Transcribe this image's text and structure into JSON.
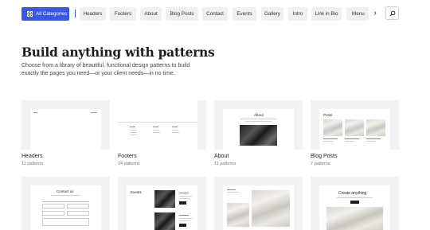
{
  "categories": {
    "active": "All Categories",
    "items": [
      "Headers",
      "Footers",
      "About",
      "Blog Posts",
      "Contact",
      "Events",
      "Gallery",
      "Intro",
      "Link in Bio",
      "Menu"
    ]
  },
  "heading": {
    "title": "Build anything with patterns",
    "subtitle": "Choose from a library of beautiful, functional design patterns to build exactly the pages you need—or your client needs—in no time."
  },
  "cards": [
    {
      "name": "Headers",
      "count": "11 patterns"
    },
    {
      "name": "Footers",
      "count": "14 patterns"
    },
    {
      "name": "About",
      "count": "11 patterns"
    },
    {
      "name": "Blog Posts",
      "count": "7 patterns"
    }
  ],
  "previews": {
    "about_heading": "About",
    "posts_heading": "Posts",
    "contact_heading": "Contact us",
    "events_heading": "Events",
    "create_heading": "Create anything"
  },
  "colors": {
    "accent": "#3858e9",
    "chip": "#f0f0f0",
    "card_bg": "#f2f2f2"
  },
  "icons": {
    "categories": "grid-icon",
    "scroll": "chevron-right-icon",
    "search": "search-icon"
  }
}
